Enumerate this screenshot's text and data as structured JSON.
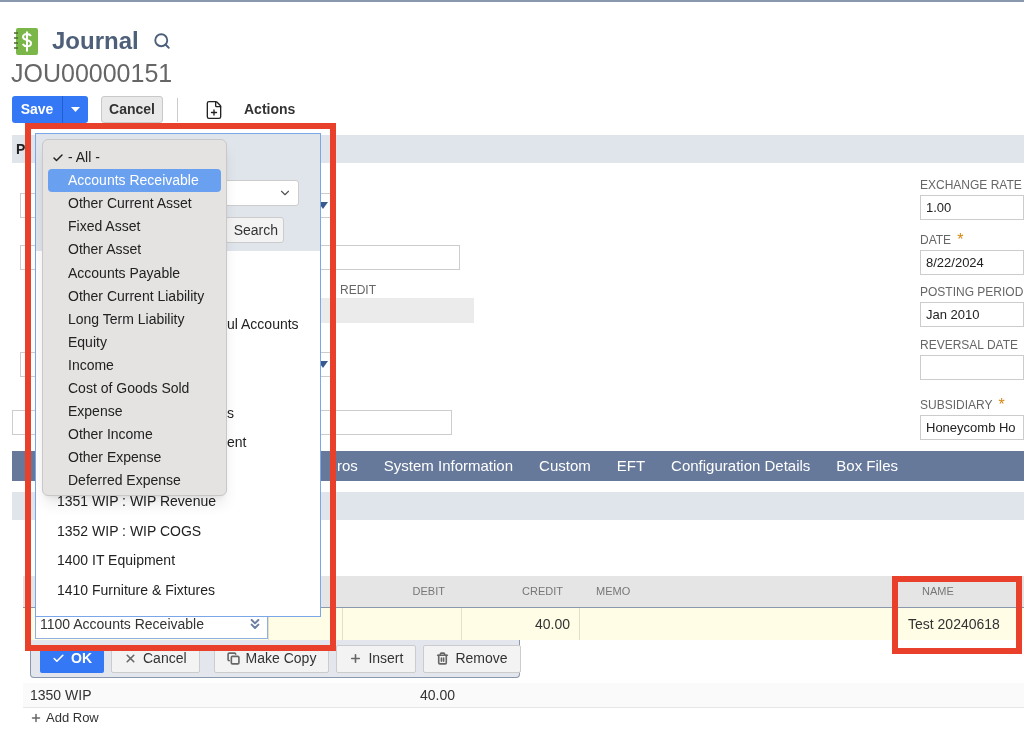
{
  "page": {
    "title": "Journal",
    "record_id": "JOU00000151"
  },
  "toolbar": [
    {
      "label": "Save",
      "kind": "primary"
    },
    {
      "label": "Cancel",
      "kind": "secondary"
    },
    {
      "label": "Actions",
      "kind": "menu"
    }
  ],
  "section_header": "P",
  "form": {
    "credit_label": "REDIT",
    "right_fields": [
      {
        "label": "EXCHANGE RATE",
        "value": "1.00"
      },
      {
        "label": "DATE",
        "value": "8/22/2024",
        "required_mark": "*"
      },
      {
        "label": "POSTING PERIOD",
        "value": "Jan 2010"
      },
      {
        "label": "REVERSAL DATE"
      },
      {
        "label": "SUBSIDIARY",
        "value": "Honeycomb Ho",
        "required_mark": "*"
      }
    ]
  },
  "tabs": [
    "ros",
    "System Information",
    "Custom",
    "EFT",
    "Configuration Details",
    "Box Files"
  ],
  "account_popup": {
    "search_button": "Search",
    "list": [
      {
        "label": "ul Accounts",
        "kind": "partial"
      },
      {
        "label": "s",
        "kind": "partial"
      },
      {
        "label": "ent",
        "kind": "partial"
      },
      {
        "label": "1351 WIP : WIP Revenue",
        "kind": "full"
      },
      {
        "label": "1352 WIP : WIP COGS",
        "kind": "full"
      },
      {
        "label": "1400 IT Equipment",
        "kind": "full"
      },
      {
        "label": "1410 Furniture & Fixtures",
        "kind": "full"
      }
    ],
    "type_menu": [
      {
        "label": "- All -",
        "selected": true,
        "highlighted": false
      },
      {
        "label": "Accounts Receivable",
        "selected": false,
        "highlighted": true
      },
      {
        "label": "Other Current Asset",
        "selected": false,
        "highlighted": false
      },
      {
        "label": "Fixed Asset",
        "selected": false,
        "highlighted": false
      },
      {
        "label": "Other Asset",
        "selected": false,
        "highlighted": false
      },
      {
        "label": "Accounts Payable",
        "selected": false,
        "highlighted": false
      },
      {
        "label": "Other Current Liability",
        "selected": false,
        "highlighted": false
      },
      {
        "label": "Long Term Liability",
        "selected": false,
        "highlighted": false
      },
      {
        "label": "Equity",
        "selected": false,
        "highlighted": false
      },
      {
        "label": "Income",
        "selected": false,
        "highlighted": false
      },
      {
        "label": "Cost of Goods Sold",
        "selected": false,
        "highlighted": false
      },
      {
        "label": "Expense",
        "selected": false,
        "highlighted": false
      },
      {
        "label": "Other Income",
        "selected": false,
        "highlighted": false
      },
      {
        "label": "Other Expense",
        "selected": false,
        "highlighted": false
      },
      {
        "label": "Deferred Expense",
        "selected": false,
        "highlighted": false
      }
    ]
  },
  "lines": {
    "columns": [
      "DEBIT",
      "CREDIT",
      "MEMO",
      "NAME"
    ],
    "active_row": {
      "account": "1100 Accounts Receivable",
      "credit": "40.00",
      "name": "Test 20240618"
    },
    "row_buttons": [
      {
        "label": "OK",
        "kind": "check"
      },
      {
        "label": "Cancel",
        "kind": "close"
      },
      {
        "label": "Make Copy",
        "kind": "copy"
      },
      {
        "label": "Insert",
        "kind": "plus"
      },
      {
        "label": "Remove",
        "kind": "trash"
      }
    ],
    "rows": [
      {
        "account": "1350 WIP",
        "debit": "40.00"
      }
    ],
    "add_row": "Add Row"
  }
}
